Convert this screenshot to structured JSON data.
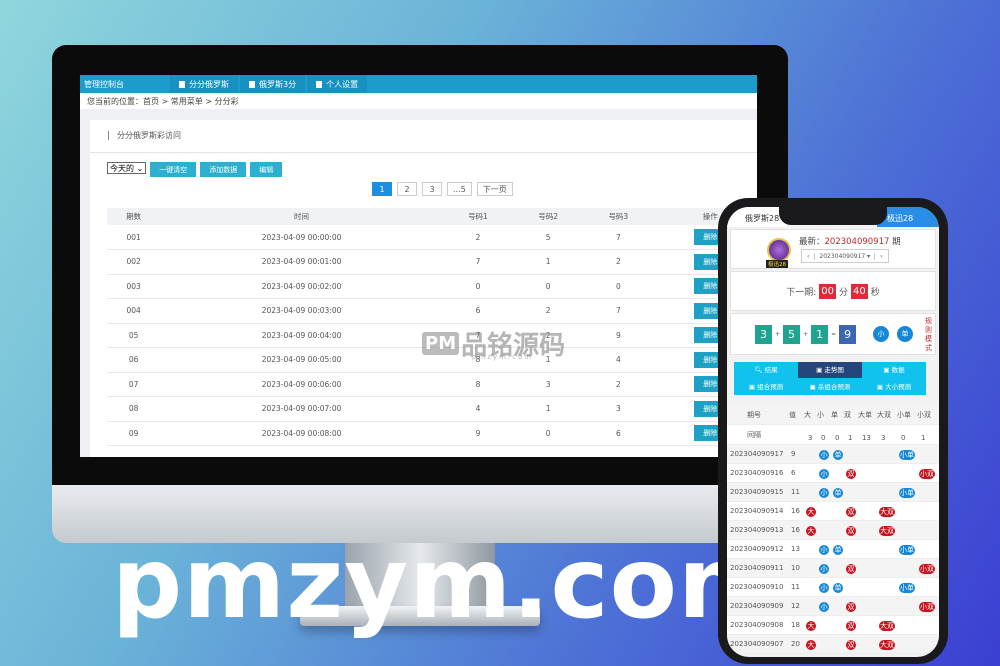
{
  "brand_text": "pmzym.com",
  "watermark": {
    "logo": "PM",
    "name": "品铭源码",
    "sub": "pmzym.com"
  },
  "admin": {
    "brand": "管理控制台",
    "nav": [
      "分分俄罗斯",
      "俄罗斯3分",
      "个人设置"
    ],
    "breadcrumb": "您当前的位置：首页 > 常用菜单 > 分分彩",
    "panel_title": "分分俄罗斯彩访问",
    "filter_value": "今天的",
    "buttons": [
      "一键清空",
      "添加数据",
      "编辑"
    ],
    "pager": [
      "1",
      "2",
      "3",
      "...5",
      "下一页"
    ],
    "pager_active": "1",
    "columns": [
      "期数",
      "时间",
      "号码1",
      "号码2",
      "号码3",
      "操作"
    ],
    "delete_label": "删除",
    "rows": [
      [
        "001",
        "2023-04-09 00:00:00",
        "2",
        "5",
        "7"
      ],
      [
        "002",
        "2023-04-09 00:01:00",
        "7",
        "1",
        "2"
      ],
      [
        "003",
        "2023-04-09 00:02:00",
        "0",
        "0",
        "0"
      ],
      [
        "004",
        "2023-04-09 00:03:00",
        "6",
        "2",
        "7"
      ],
      [
        "05",
        "2023-04-09 00:04:00",
        "7",
        "2",
        "9"
      ],
      [
        "06",
        "2023-04-09 00:05:00",
        "8",
        "1",
        "4"
      ],
      [
        "07",
        "2023-04-09 00:06:00",
        "8",
        "3",
        "2"
      ],
      [
        "08",
        "2023-04-09 00:07:00",
        "4",
        "1",
        "3"
      ],
      [
        "09",
        "2023-04-09 00:08:00",
        "9",
        "0",
        "6"
      ]
    ]
  },
  "mobile": {
    "tab_left": "俄罗斯28",
    "tab_right": "极迅28",
    "logo_text": "极迅28",
    "latest_label": "最新：",
    "latest_period": "202304090917",
    "period_suffix": "期",
    "period_select": "202304090917 ▾",
    "next_label": "下一期:",
    "min": "00",
    "min_label": "分",
    "sec": "40",
    "sec_label": "秒",
    "balls": [
      "3",
      "5",
      "1",
      "9"
    ],
    "ops": [
      "+",
      "+",
      "="
    ],
    "tags": [
      "小",
      "单"
    ],
    "mode_label": "规则模式",
    "menu": [
      "结果",
      "走势图",
      "数据",
      "组合预测",
      "杀组合预测",
      "大小预测"
    ],
    "menu_active": "走势图",
    "headers": [
      "期号",
      "值",
      "大",
      "小",
      "单",
      "双",
      "大单",
      "大双",
      "小单",
      "小双"
    ],
    "gap_label": "间隔",
    "gaps": [
      "3",
      "0",
      "0",
      "1",
      "13",
      "3",
      "0",
      "1"
    ],
    "rows": [
      {
        "p": "202304090917",
        "v": "9",
        "m": [
          "",
          "小",
          "单",
          "",
          "",
          "",
          "小单",
          ""
        ]
      },
      {
        "p": "202304090916",
        "v": "6",
        "m": [
          "",
          "小",
          "",
          "双",
          "",
          "",
          "",
          "小双"
        ]
      },
      {
        "p": "202304090915",
        "v": "11",
        "m": [
          "",
          "小",
          "单",
          "",
          "",
          "",
          "小单",
          ""
        ]
      },
      {
        "p": "202304090914",
        "v": "16",
        "m": [
          "大",
          "",
          "",
          "双",
          "",
          "大双",
          "",
          ""
        ]
      },
      {
        "p": "202304090913",
        "v": "16",
        "m": [
          "大",
          "",
          "",
          "双",
          "",
          "大双",
          "",
          ""
        ]
      },
      {
        "p": "202304090912",
        "v": "13",
        "m": [
          "",
          "小",
          "单",
          "",
          "",
          "",
          "小单",
          ""
        ]
      },
      {
        "p": "202304090911",
        "v": "10",
        "m": [
          "",
          "小",
          "",
          "双",
          "",
          "",
          "",
          "小双"
        ]
      },
      {
        "p": "202304090910",
        "v": "11",
        "m": [
          "",
          "小",
          "单",
          "",
          "",
          "",
          "小单",
          ""
        ]
      },
      {
        "p": "202304090909",
        "v": "12",
        "m": [
          "",
          "小",
          "",
          "双",
          "",
          "",
          "",
          "小双"
        ]
      },
      {
        "p": "202304090908",
        "v": "18",
        "m": [
          "大",
          "",
          "",
          "双",
          "",
          "大双",
          "",
          ""
        ]
      },
      {
        "p": "202304090907",
        "v": "20",
        "m": [
          "大",
          "",
          "",
          "双",
          "",
          "大双",
          "",
          ""
        ]
      }
    ]
  },
  "colors": {
    "accent": "#1b9ccc",
    "blue_tag": "#1687d6",
    "red_tag": "#c8121e",
    "ball": "#1fa58f"
  }
}
